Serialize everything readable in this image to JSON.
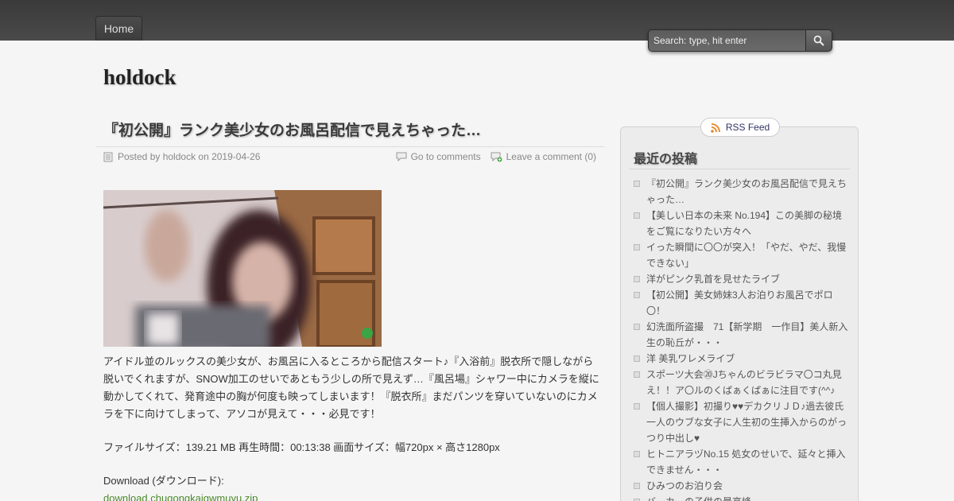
{
  "nav": {
    "home_label": "Home"
  },
  "search": {
    "placeholder": "Search: type, hit enter"
  },
  "site": {
    "title": "holdock"
  },
  "post": {
    "title": "『初公開』ランク美少女のお風呂配信で見えちゃった…",
    "meta_posted": "Posted by holdock on 2019-04-26",
    "go_to_comments": "Go to comments",
    "leave_comment": "Leave a comment (0)",
    "body_paragraph": "アイドル並のルックスの美少女が、お風呂に入るところから配信スタート♪『入浴前』脱衣所で隠しながら脱いでくれますが、SNOW加工のせいであともう少しの所で見えず…『風呂場』シャワー中にカメラを縦に動かしてくれて、発育途中の胸が何度も映ってしまいます！『脱衣所』まだパンツを穿いていないのにカメラを下に向けてしまって、アソコが見えて・・・必見です！",
    "file_info": "ファイルサイズ：139.21 MB 再生時間：00:13:38 画面サイズ：幅720px × 高さ1280px",
    "download_label": "Download (ダウンロード):",
    "download_link": "download.chugongkaigwmuyu.zip"
  },
  "sidebar": {
    "rss_label": "RSS Feed",
    "widget_title": "最近の投稿",
    "recent_posts": [
      "『初公開』ランク美少女のお風呂配信で見えちゃった…",
      "【美しい日本の未来 No.194】この美脚の秘境をご覧になりたい方々へ",
      "イった瞬間に〇〇が突入！「やだ、やだ、我慢できない」",
      "洋がピンク乳首を見せたライブ",
      "【初公開】美女姉妹3人お泊りお風呂でポロ〇！",
      "幻洗面所盗撮　71【新学期　一作目】美人新入生の恥丘が・・・",
      "洋 美乳ワレメライブ",
      "スポーツ大会⑳Jちゃんのビラビラマ〇コ丸見え！！ア〇ルのくぱぁくぱぁに注目です(^^♪",
      "【個人撮影】初撮り♥♥デカクリＪＤ♪過去彼氏一人のウブな女子に人生初の生挿入からのがっつり中出し♥",
      "ヒトニアラヅNo.15 処女のせいで、延々と挿入できません・・・",
      "ひみつのお泊り会",
      "バーカーの子供の最高峰"
    ]
  }
}
